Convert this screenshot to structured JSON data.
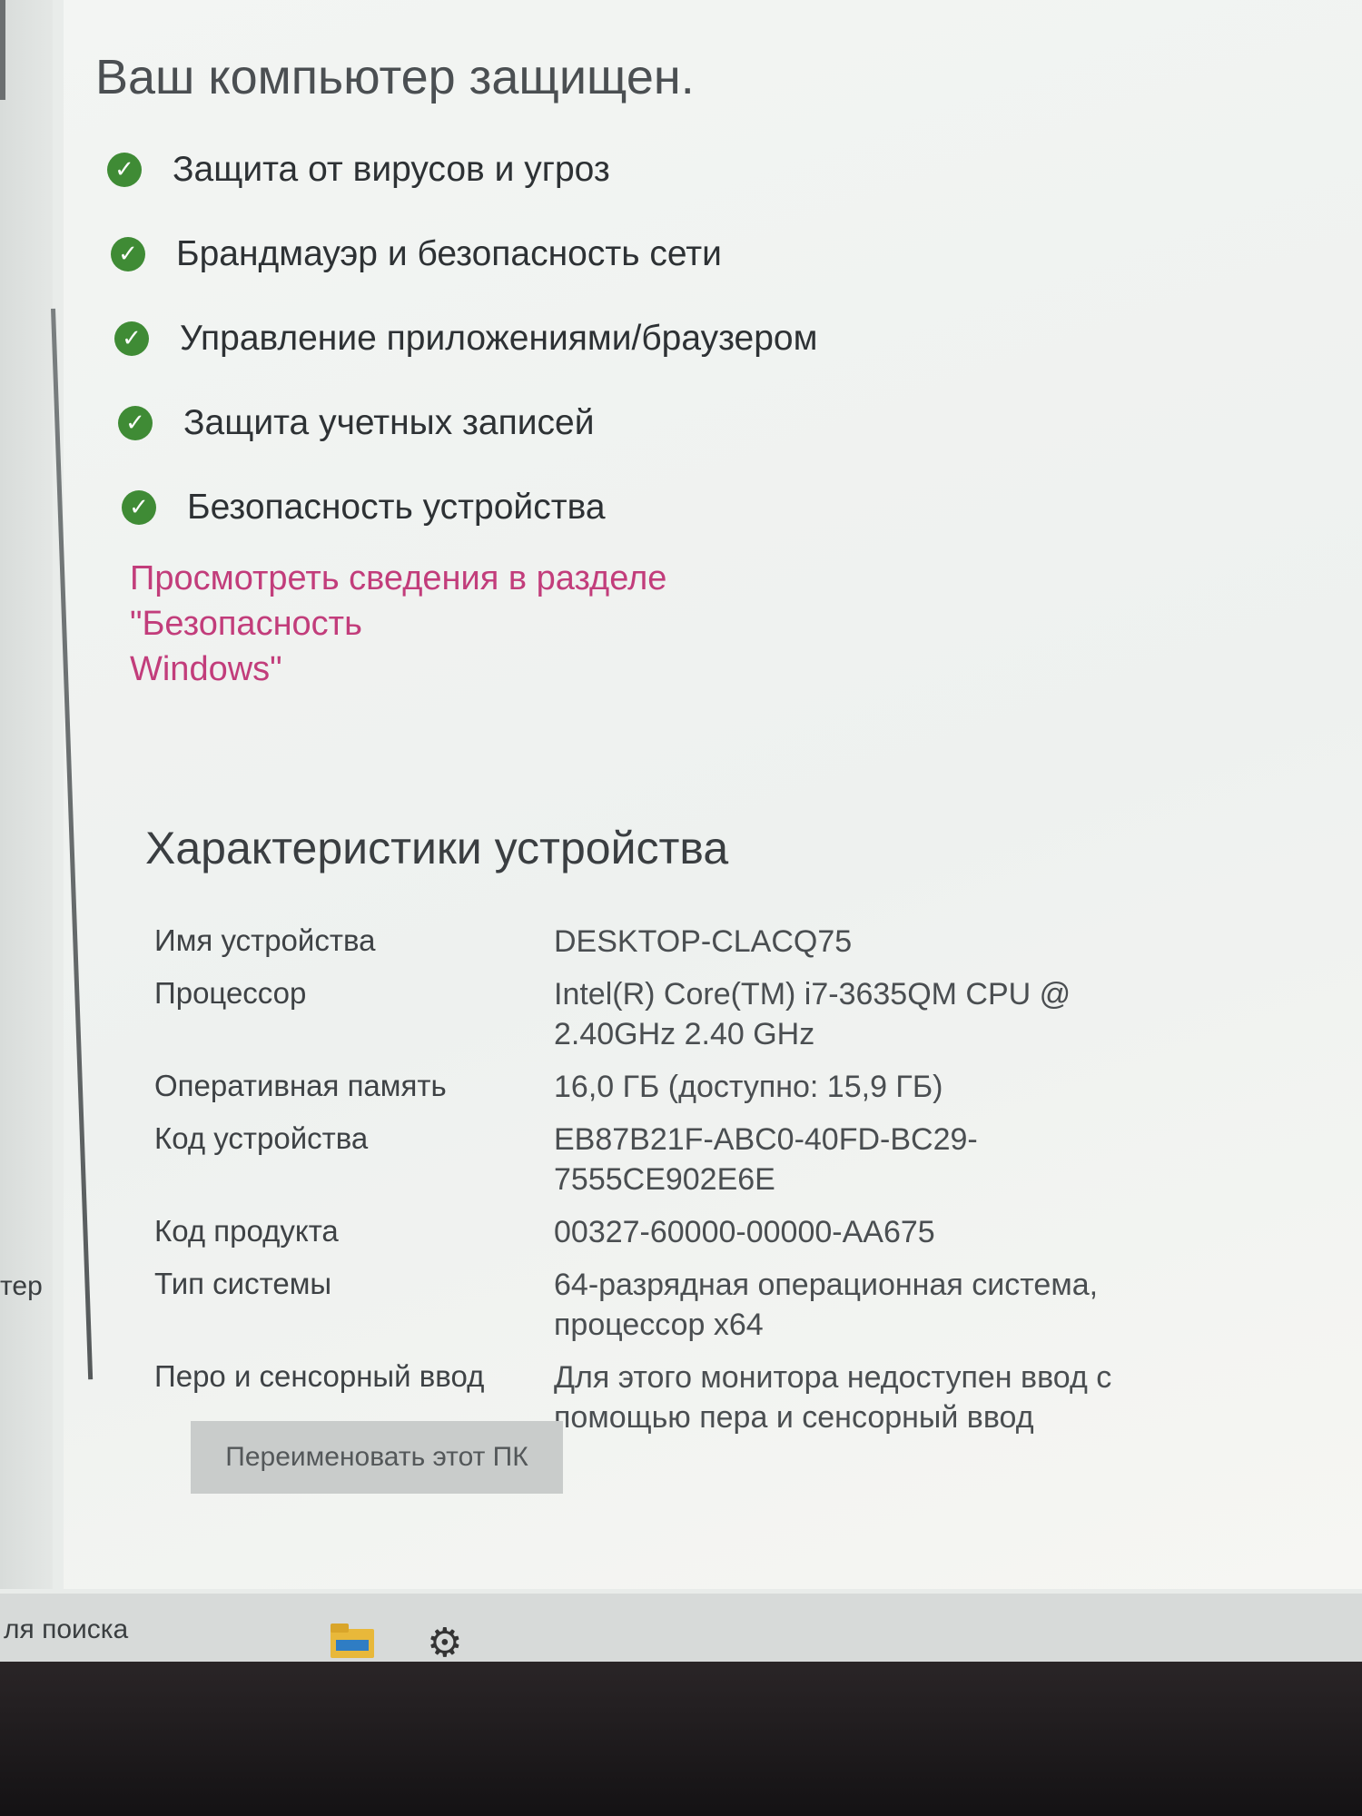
{
  "security": {
    "heading": "Ваш компьютер защищен.",
    "items": [
      {
        "label": "Защита от вирусов и угроз",
        "icon": "check-circle-icon"
      },
      {
        "label": "Брандмауэр и безопасность сети",
        "icon": "check-circle-icon"
      },
      {
        "label": "Управление приложениями/браузером",
        "icon": "check-circle-icon"
      },
      {
        "label": "Защита учетных записей",
        "icon": "check-circle-icon"
      },
      {
        "label": "Безопасность устройства",
        "icon": "check-circle-icon"
      }
    ],
    "link_line1": "Просмотреть сведения в разделе \"Безопасность",
    "link_line2": "Windows\""
  },
  "specs": {
    "title": "Характеристики устройства",
    "rows": [
      {
        "key": "Имя устройства",
        "value": "DESKTOP-CLACQ75"
      },
      {
        "key": "Процессор",
        "value": "Intel(R) Core(TM) i7-3635QM CPU @ 2.40GHz   2.40 GHz"
      },
      {
        "key": "Оперативная память",
        "value": "16,0 ГБ (доступно: 15,9 ГБ)"
      },
      {
        "key": "Код устройства",
        "value": "EB87B21F-ABC0-40FD-BC29-7555CE902E6E"
      },
      {
        "key": "Код продукта",
        "value": "00327-60000-00000-AA675"
      },
      {
        "key": "Тип системы",
        "value": "64-разрядная операционная система, процессор x64"
      },
      {
        "key": "Перо и сенсорный ввод",
        "value": "Для этого монитора недоступен ввод с помощью пера и сенсорный ввод"
      }
    ],
    "rename_button": "Переименовать этот ПК"
  },
  "sidebar": {
    "partial_text": "тер"
  },
  "taskbar": {
    "search_partial": "ля поиска",
    "icons": [
      "folder-icon",
      "gear-icon"
    ]
  },
  "colors": {
    "check": "#3f8b35",
    "link": "#c23d7b",
    "active_indicator": "#d94b74"
  }
}
